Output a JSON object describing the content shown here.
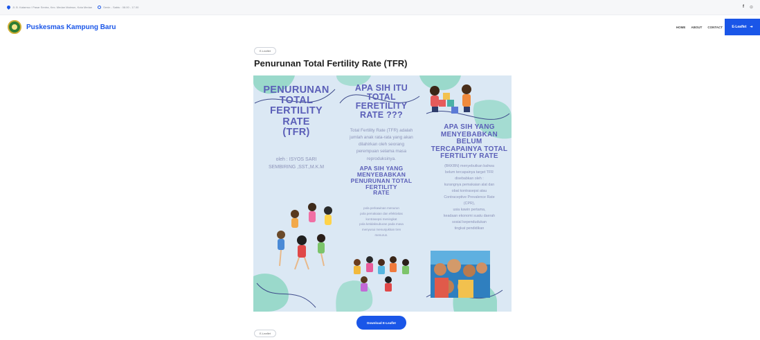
{
  "topbar": {
    "address": "Jl. B. Katamso / Pasar Sentra, Kec. Medan Maimun, Kota Medan",
    "hours": "Senin - Sabtu : 08.00 - 17.00",
    "social": [
      "f",
      "⊙"
    ]
  },
  "header": {
    "brand": "Puskesmas Kampung Baru",
    "nav": [
      "HOME",
      "ABOUT",
      "CONTACT"
    ],
    "cta_label": "E-Leaflet",
    "cta_arrow": "➜"
  },
  "content": {
    "badge_top": "E-Leaflet",
    "title": "Penurunan Total Fertility Rate (TFR)",
    "download_label": "Download E-Leaflet",
    "badge_bottom": "E-Leaflet"
  },
  "leaflet": {
    "col1": {
      "heading": [
        "PENURUNAN",
        "TOTAL",
        "FERTILITY RATE",
        "(TFR)"
      ],
      "author": [
        "oleh : ISYOS SARI",
        "SEMBIRING ,SST.,M.K.M"
      ]
    },
    "col2": {
      "heading": [
        "APA SIH ITU",
        "TOTAL FERETILITY",
        "RATE ???"
      ],
      "body": [
        "Total Fertility Rate (TFR) adalah",
        "jumlah anak rata-rata yang akan",
        "dilahirkan oleh seorang",
        "perempuan selama masa",
        "reproduksinya."
      ],
      "subheading": [
        "APA SIH YANG MENYEBABKAN",
        "PENURUNAN TOTAL FERTILITY",
        "RATE"
      ],
      "bullets": [
        "pola perkawinan menurun",
        "pola pemakaian dan efektivitas",
        "kontrasepsi meningkat",
        "pola ketidaksuburan pada masa",
        "menyusui menunjukkan tren",
        "menurun."
      ]
    },
    "col3": {
      "heading": [
        "APA SIH YANG",
        "MENYEBABKAN BELUM",
        "TERCAPAINYA TOTAL",
        "FERTILITY RATE"
      ],
      "intro": [
        "(BKKBN) menyebutkan bahwa",
        "belum tercapainya target TFR",
        "disebabkan oleh :"
      ],
      "bullets": [
        "kurangnya pemakaian alat dan",
        "obat kontrasepsi atau",
        "Contraceptive Prevalence Rate",
        "(CPR),",
        "usia kawin pertama,",
        "keadaan ekonomi suatu daerah",
        "sosial kependudukan",
        "tingkat pendidikan"
      ]
    }
  },
  "colors": {
    "brand_blue": "#1a56e8",
    "poster_bg": "#dbe8f4",
    "poster_heading": "#5b5fb8",
    "poster_text": "#8c93b8",
    "blob_teal": "#9ad9cb"
  }
}
